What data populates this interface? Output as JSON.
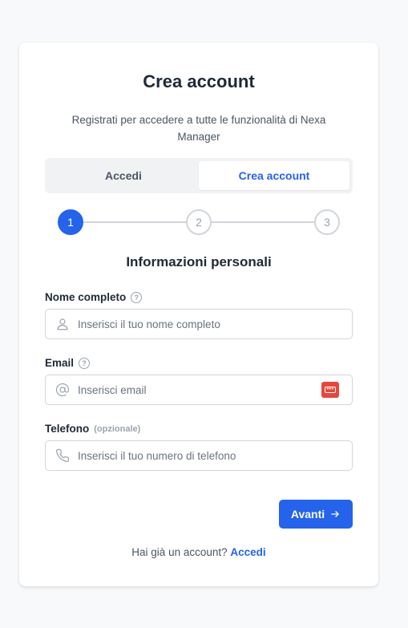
{
  "header": {
    "title": "Crea account",
    "subtitle": "Registrati per accedere a tutte le funzionalità di Nexa Manager"
  },
  "tabs": [
    {
      "label": "Accedi",
      "active": false
    },
    {
      "label": "Crea account",
      "active": true
    }
  ],
  "stepper": {
    "steps": [
      "1",
      "2",
      "3"
    ],
    "current": 1
  },
  "section_title": "Informazioni personali",
  "fields": {
    "name": {
      "label": "Nome completo",
      "placeholder": "Inserisci il tuo nome completo",
      "value": "",
      "icon": "user-icon"
    },
    "email": {
      "label": "Email",
      "placeholder": "Inserisci email",
      "value": "",
      "icon": "at-sign-icon"
    },
    "phone": {
      "label": "Telefono",
      "optional": "(opzionale)",
      "placeholder": "Inserisci il tuo numero di telefono",
      "value": "",
      "icon": "phone-icon"
    }
  },
  "next_button": {
    "label": "Avanti"
  },
  "footer": {
    "text": "Hai già un account?",
    "link": "Accedi"
  },
  "colors": {
    "accent": "#2563eb",
    "password_manager": "#e5483b"
  }
}
